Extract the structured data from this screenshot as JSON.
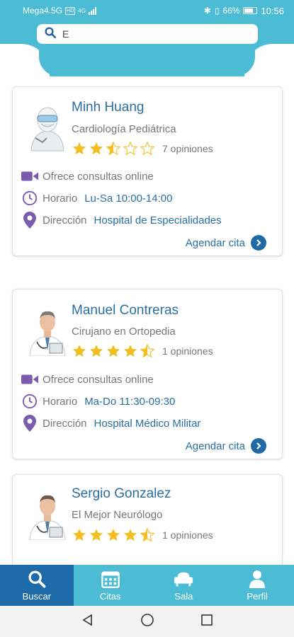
{
  "status_bar": {
    "carrier": "Mega4.5G",
    "hd": "HD",
    "network": "4G",
    "battery": "66%",
    "time": "10:56"
  },
  "search": {
    "value": "E",
    "placeholder": ""
  },
  "doctors": [
    {
      "name": "Minh Huang",
      "specialty": "Cardiología Pediátrica",
      "rating": 2.5,
      "reviews": "7 opiniones",
      "online": "Ofrece consultas online",
      "schedule_label": "Horario",
      "schedule": "Lu-Sa 10:00-14:00",
      "address_label": "Dirección",
      "address": "Hospital de Especialidades",
      "action": "Agendar cita",
      "avatar": "doctor-ppe-avatar"
    },
    {
      "name": "Manuel Contreras",
      "specialty": "Cirujano en Ortopedia",
      "rating": 4.5,
      "reviews": "1 opiniones",
      "online": "Ofrece consultas online",
      "schedule_label": "Horario",
      "schedule": "Ma-Do 11:30-09:30",
      "address_label": "Dirección",
      "address": "Hospital Médico Militar",
      "action": "Agendar cita",
      "avatar": "doctor-avatar"
    },
    {
      "name": "Sergio Gonzalez",
      "specialty": "El Mejor Neurólogo",
      "rating": 4.5,
      "reviews": "1 opiniones",
      "avatar": "doctor-avatar"
    }
  ],
  "nav": [
    {
      "label": "Buscar",
      "icon": "search-icon",
      "active": true
    },
    {
      "label": "Citas",
      "icon": "calendar-icon",
      "active": false
    },
    {
      "label": "Sala",
      "icon": "armchair-icon",
      "active": false
    },
    {
      "label": "Perfil",
      "icon": "person-icon",
      "active": false
    }
  ],
  "colors": {
    "header": "#4bbcd4",
    "nav_active": "#1d6aa8",
    "link": "#2a6fa0",
    "star": "#f2be22",
    "icon_purple": "#7a5bb0"
  }
}
